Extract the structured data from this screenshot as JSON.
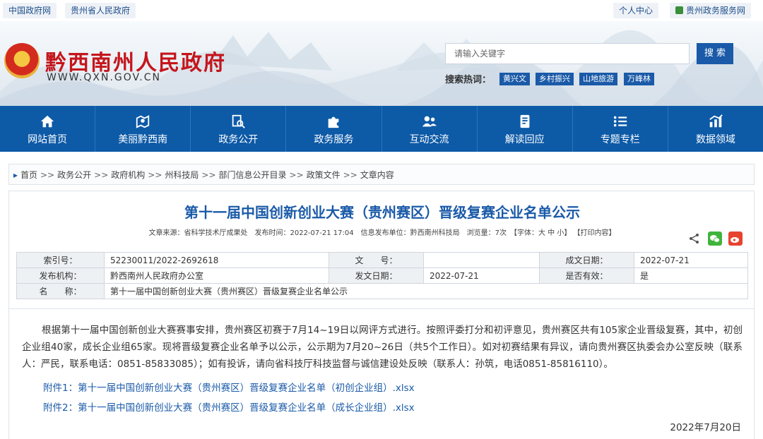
{
  "topbar": {
    "left_links": [
      "中国政府网",
      "贵州省人民政府"
    ],
    "right_links": [
      "个人中心",
      "贵州政务服务网"
    ]
  },
  "header": {
    "site_name": "黔西南州人民政府",
    "site_url": "WWW.QXN.GOV.CN",
    "search_placeholder": "请输入关键字",
    "search_button": "搜 索",
    "hot_label": "搜索热词：",
    "hot_tags": [
      "黄兴文",
      "乡村振兴",
      "山地旅游",
      "万峰林"
    ]
  },
  "nav": [
    {
      "label": "网站首页",
      "icon": "home-icon"
    },
    {
      "label": "美丽黔西南",
      "icon": "map-pin-icon"
    },
    {
      "label": "政务公开",
      "icon": "document-search-icon"
    },
    {
      "label": "政务服务",
      "icon": "puzzle-icon"
    },
    {
      "label": "互动交流",
      "icon": "people-icon"
    },
    {
      "label": "解读回应",
      "icon": "notes-icon"
    },
    {
      "label": "专题专栏",
      "icon": "list-icon"
    },
    {
      "label": "数据领域",
      "icon": "chart-icon"
    }
  ],
  "breadcrumb": [
    "首页",
    "政务公开",
    "政府机构",
    "州科技局",
    "部门信息公开目录",
    "政策文件",
    "文章内容"
  ],
  "article": {
    "title": "第十一届中国创新创业大赛（贵州赛区）晋级复赛企业名单公示",
    "meta": "文章来源：省科学技术厅成果处　发布时间：2022-07-21 17:04　信息发布单位：黔西南州科技局　浏览量：7次　【字体：大 中 小】 【打印内容】",
    "info": {
      "r1": [
        "索引号：",
        "52230011/2022-2692618",
        "文　　号：",
        "",
        "成文日期：",
        "2022-07-21"
      ],
      "r2": [
        "发布机构：",
        "黔西南州人民政府办公室",
        "发文日期：",
        "2022-07-21",
        "是否有效：",
        "是"
      ],
      "r3": [
        "名　　称：",
        "第十一届中国创新创业大赛（贵州赛区）晋级复赛企业名单公示"
      ]
    }
  },
  "content": {
    "paragraph": "根据第十一届中国创新创业大赛赛事安排，贵州赛区初赛于7月14~19日以网评方式进行。按照评委打分和初评意见，贵州赛区共有105家企业晋级复赛，其中，初创企业组40家，成长企业组65家。现将晋级复赛企业名单予以公示，公示期为7月20~26日（共5个工作日）。如对初赛结果有异议，请向贵州赛区执委会办公室反映（联系人：严民，联系电话：0851-85833085）；如有投诉，请向省科技厅科技监督与诚信建设处反映（联系人：孙筑，电话0851-85816110）。",
    "attachment1": "附件1：第十一届中国创新创业大赛（贵州赛区）晋级复赛企业名单（初创企业组）.xlsx",
    "attachment2": "附件2：第十一届中国创新创业大赛（贵州赛区）晋级复赛企业名单（成长企业组）.xlsx",
    "date": "2022年7月20日"
  },
  "colors": {
    "primary": "#0d5aa7",
    "title_red": "#c4161c",
    "link": "#1a5aa8"
  }
}
